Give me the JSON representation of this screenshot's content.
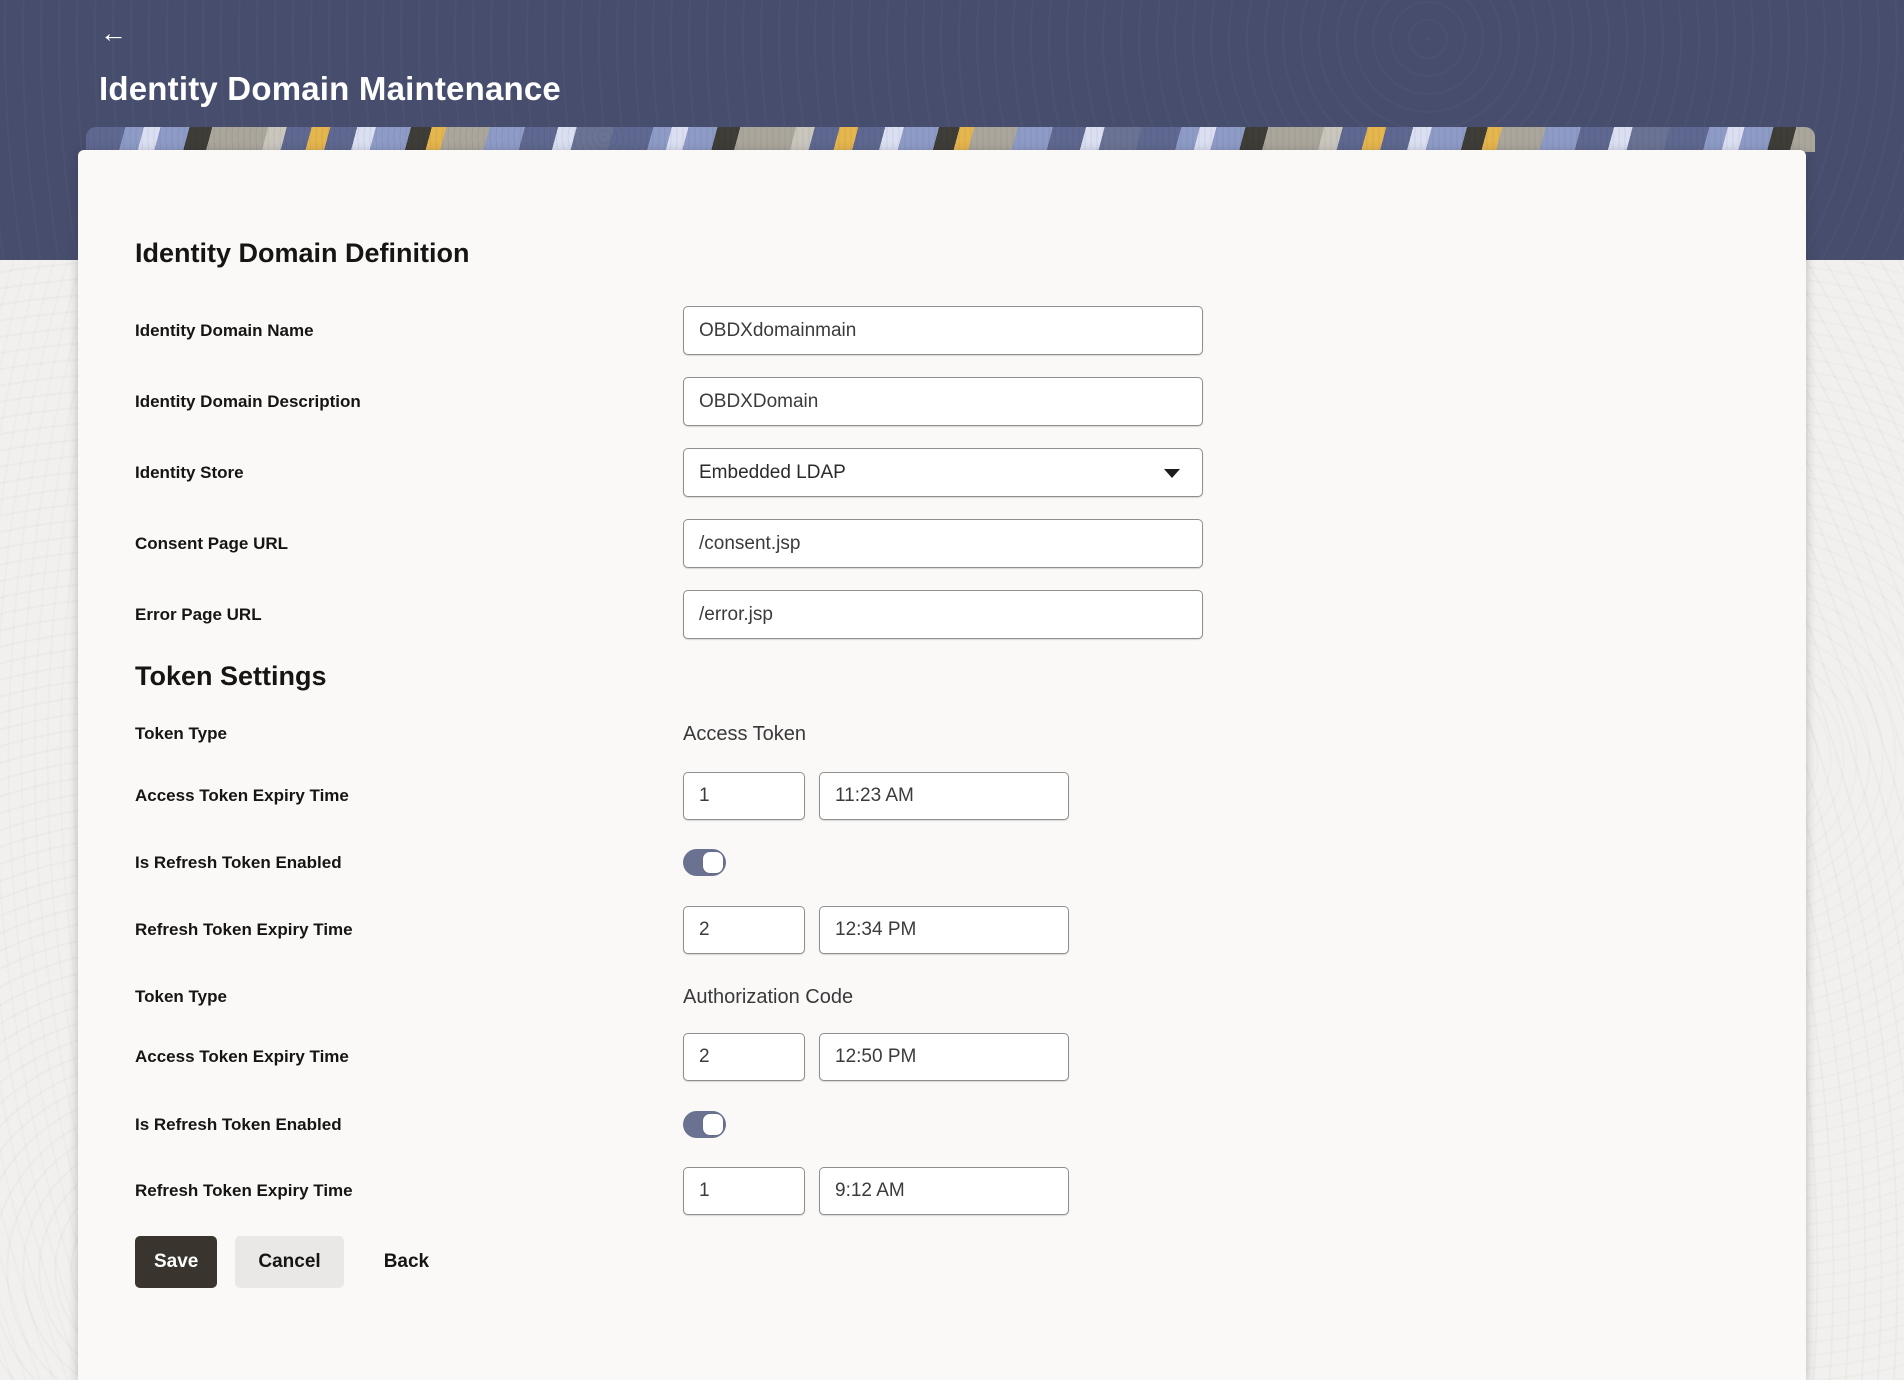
{
  "header": {
    "back_arrow": "←",
    "title": "Identity Domain Maintenance"
  },
  "definition": {
    "heading": "Identity Domain Definition",
    "fields": {
      "name": {
        "label": "Identity Domain Name",
        "value": "OBDXdomainmain"
      },
      "description": {
        "label": "Identity Domain Description",
        "value": "OBDXDomain"
      },
      "store": {
        "label": "Identity Store",
        "value": "Embedded LDAP"
      },
      "consent_url": {
        "label": "Consent Page URL",
        "value": "/consent.jsp"
      },
      "error_url": {
        "label": "Error Page URL",
        "value": "/error.jsp"
      }
    }
  },
  "token_settings": {
    "heading": "Token Settings",
    "groups": [
      {
        "token_type_label": "Token Type",
        "token_type": "Access Token",
        "access_expiry_label": "Access Token Expiry Time",
        "access_expiry_value": "1",
        "access_expiry_time": "11:23 AM",
        "refresh_enabled_label": "Is Refresh Token Enabled",
        "refresh_enabled_state": "on",
        "refresh_expiry_label": "Refresh Token Expiry Time",
        "refresh_expiry_value": "2",
        "refresh_expiry_time": "12:34 PM"
      },
      {
        "token_type_label": "Token Type",
        "token_type": "Authorization Code",
        "access_expiry_label": "Access Token Expiry Time",
        "access_expiry_value": "2",
        "access_expiry_time": "12:50 PM",
        "refresh_enabled_label": "Is Refresh Token Enabled",
        "refresh_enabled_state": "on",
        "refresh_expiry_label": "Refresh Token Expiry Time",
        "refresh_expiry_value": "1",
        "refresh_expiry_time": "9:12 AM"
      }
    ]
  },
  "actions": {
    "save": "Save",
    "cancel": "Cancel",
    "back": "Back"
  },
  "colors": {
    "header_bg": "#474d6c",
    "toggle_on": "#6b7291",
    "save_bg": "#3a342f",
    "banner_yellow": "#e5b54e",
    "banner_slate": "#5f6890",
    "banner_charcoal": "#3f3d38"
  }
}
